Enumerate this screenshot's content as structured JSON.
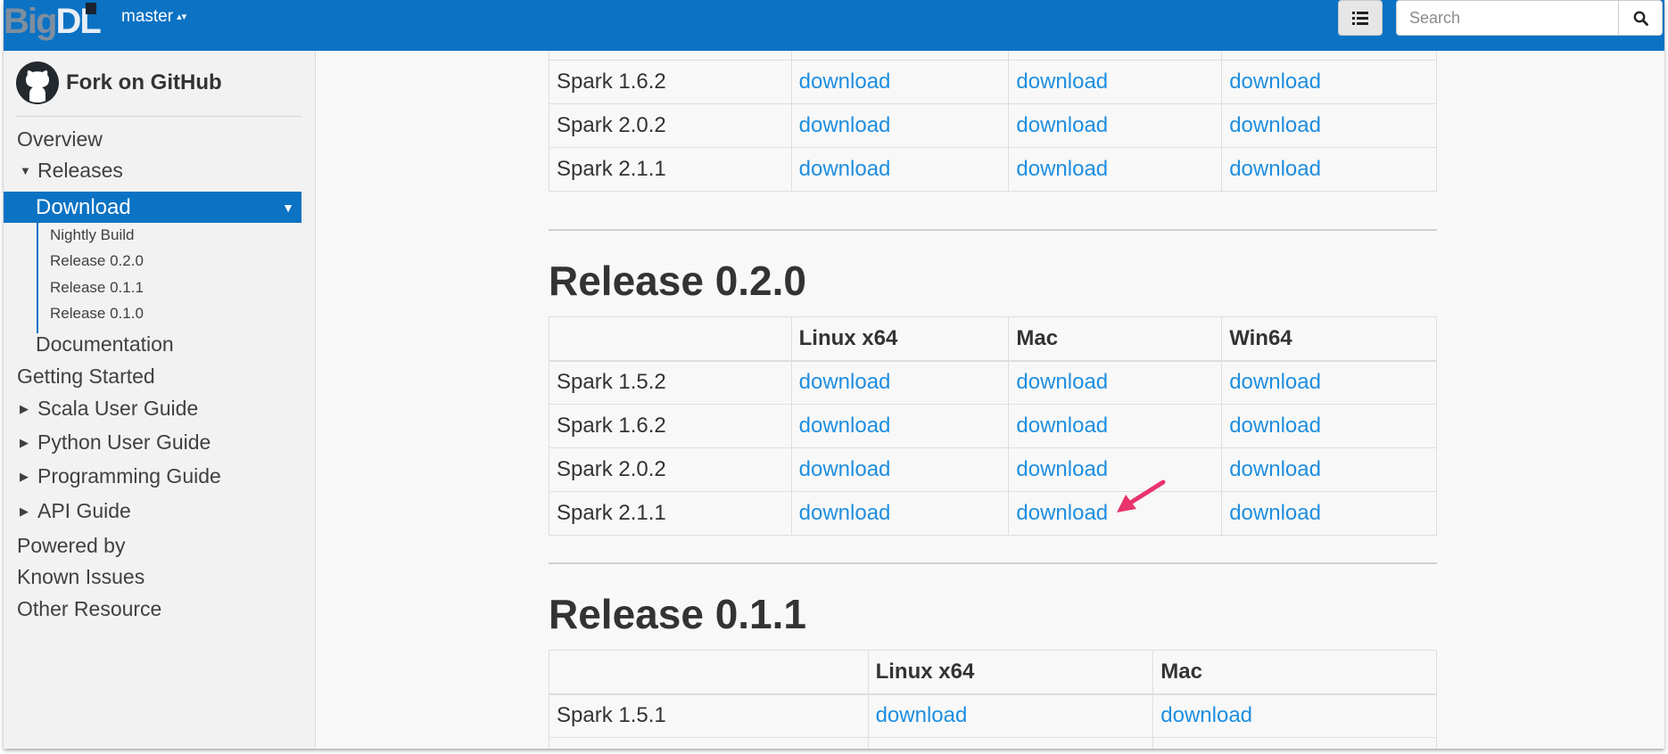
{
  "topbar": {
    "logo_dim": "Big",
    "logo_bright": "DL",
    "version": "master",
    "version_caret": "▴▾",
    "toc_icon": "list-icon",
    "search_placeholder": "Search",
    "search_icon": "magnifier-icon"
  },
  "sidebar": {
    "fork_label": "Fork on GitHub",
    "items": [
      {
        "label": "Overview",
        "expander": ""
      },
      {
        "label": "Releases",
        "expander": "▼"
      },
      {
        "label": "Download",
        "expander": "▼"
      },
      {
        "label": "Documentation",
        "expander": ""
      },
      {
        "label": "Getting Started",
        "expander": ""
      },
      {
        "label": "Scala User Guide",
        "expander": "▶"
      },
      {
        "label": "Python User Guide",
        "expander": "▶"
      },
      {
        "label": "Programming Guide",
        "expander": "▶"
      },
      {
        "label": "API Guide",
        "expander": "▶"
      },
      {
        "label": "Powered by",
        "expander": ""
      },
      {
        "label": "Known Issues",
        "expander": ""
      },
      {
        "label": "Other Resource",
        "expander": ""
      }
    ],
    "subitems": [
      "Nightly Build",
      "Release 0.2.0",
      "Release 0.1.1",
      "Release 0.1.0"
    ]
  },
  "main": {
    "top_table": {
      "rows": [
        {
          "spark": "Spark 1.6.2",
          "links": [
            "download",
            "download",
            "download"
          ]
        },
        {
          "spark": "Spark 2.0.2",
          "links": [
            "download",
            "download",
            "download"
          ]
        },
        {
          "spark": "Spark 2.1.1",
          "links": [
            "download",
            "download",
            "download"
          ]
        }
      ]
    },
    "release_020": {
      "title": "Release 0.2.0",
      "headers": [
        "",
        "Linux x64",
        "Mac",
        "Win64"
      ],
      "rows": [
        {
          "spark": "Spark 1.5.2",
          "links": [
            "download",
            "download",
            "download"
          ]
        },
        {
          "spark": "Spark 1.6.2",
          "links": [
            "download",
            "download",
            "download"
          ]
        },
        {
          "spark": "Spark 2.0.2",
          "links": [
            "download",
            "download",
            "download"
          ]
        },
        {
          "spark": "Spark 2.1.1",
          "links": [
            "download",
            "download",
            "download"
          ]
        }
      ]
    },
    "release_011": {
      "title": "Release 0.1.1",
      "headers": [
        "",
        "Linux x64",
        "Mac"
      ],
      "rows": [
        {
          "spark": "Spark 1.5.1",
          "links": [
            "download",
            "download"
          ]
        }
      ]
    }
  },
  "colors": {
    "brand_blue": "#0b72c4",
    "link_blue": "#1e8ee0",
    "annotation_arrow": "#e8336d"
  }
}
